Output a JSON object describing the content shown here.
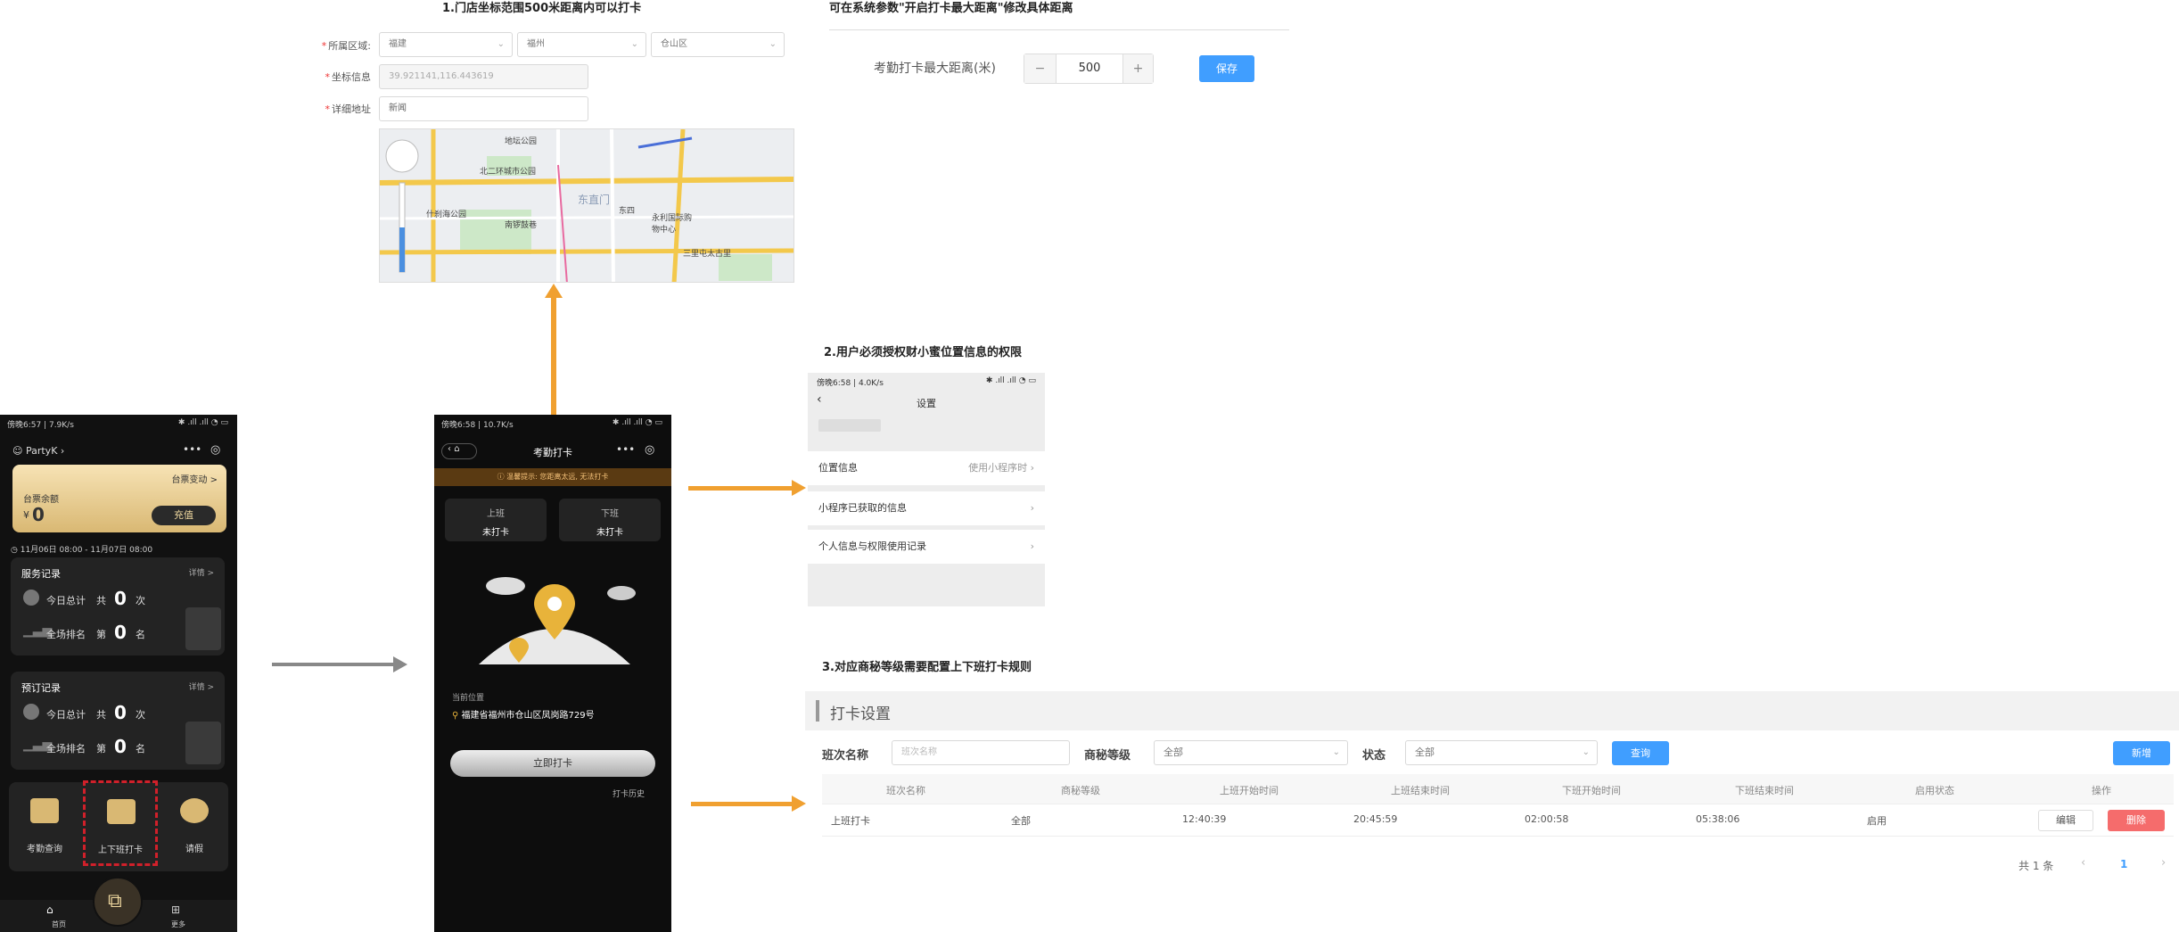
{
  "notes": {
    "n1": "1.门店坐标范围500米距离内可以打卡",
    "n_top_right": "可在系统参数\"开启打卡最大距离\"修改具体距离",
    "n2": "2.用户必须授权财小蜜位置信息的权限",
    "n3": "3.对应商秘等级需要配置上下班打卡规则"
  },
  "store_form": {
    "region_label": "所属区域:",
    "region_values": [
      "福建",
      "福州",
      "仓山区"
    ],
    "coord_label": "坐标信息",
    "coord_value": "39.921141,116.443619",
    "address_label": "详细地址",
    "address_value": "新闻"
  },
  "map": {
    "labels": [
      "地坛公园",
      "北二环城市公园",
      "什刹海公园",
      "南锣鼓巷",
      "东直门",
      "东四",
      "永利国际购物中心",
      "三里屯太古里",
      "东四",
      "东四"
    ]
  },
  "distance": {
    "label": "考勤打卡最大距离(米)",
    "minus": "−",
    "value": "500",
    "plus": "+",
    "save": "保存"
  },
  "phone1": {
    "status_left": "傍晚6:57 | 7.9K/s",
    "app_name": "PartyK",
    "balance_change": "台票变动 >",
    "balance_label": "台票余额",
    "currency": "¥",
    "balance": "0",
    "recharge": "充值",
    "date_range": "11月06日 08:00 - 11月07日 08:00",
    "service_title": "服务记录",
    "detail": "详情 >",
    "today_total": "今日总计",
    "total_pre": "共",
    "total_val": "0",
    "total_unit": "次",
    "rank_label": "全场排名",
    "rank_pre": "第",
    "rank_val": "0",
    "rank_unit": "名",
    "reserve_title": "预订记录",
    "menu": [
      "考勤查询",
      "上下班打卡",
      "请假"
    ],
    "tabbar": [
      "首页",
      "更多"
    ]
  },
  "phone2": {
    "status_left": "傍晚6:58 | 10.7K/s",
    "title": "考勤打卡",
    "warning": "温馨提示: 您距离太远, 无法打卡",
    "on_label": "上班",
    "on_status": "未打卡",
    "off_label": "下班",
    "off_status": "未打卡",
    "location_label": "当前位置",
    "location_value": "福建省福州市仓山区凤岗路729号",
    "punch_button": "立即打卡",
    "history": "打卡历史"
  },
  "settings": {
    "status_left": "傍晚6:58 | 4.0K/s",
    "title": "设置",
    "rows": [
      {
        "label": "位置信息",
        "value": "使用小程序时"
      },
      {
        "label": "小程序已获取的信息",
        "value": ""
      },
      {
        "label": "个人信息与权限使用记录",
        "value": ""
      }
    ]
  },
  "admin": {
    "title": "打卡设置",
    "filter_name_label": "班次名称",
    "filter_name_placeholder": "班次名称",
    "filter_level_label": "商秘等级",
    "filter_level_value": "全部",
    "filter_status_label": "状态",
    "filter_status_value": "全部",
    "query": "查询",
    "add": "新增",
    "columns": [
      "班次名称",
      "商秘等级",
      "上班开始时间",
      "上班结束时间",
      "下班开始时间",
      "下班结束时间",
      "启用状态",
      "操作"
    ],
    "rows": [
      {
        "name": "上班打卡",
        "level": "全部",
        "on_start": "12:40:39",
        "on_end": "20:45:59",
        "off_start": "02:00:58",
        "off_end": "05:38:06",
        "status": "启用",
        "edit": "编辑",
        "delete": "删除"
      }
    ],
    "total": "共 1 条",
    "page": "1"
  },
  "colors": {
    "accent": "#409eff",
    "arrow": "#f0a030",
    "danger": "#f56c6c",
    "gold": "#d9b873"
  }
}
